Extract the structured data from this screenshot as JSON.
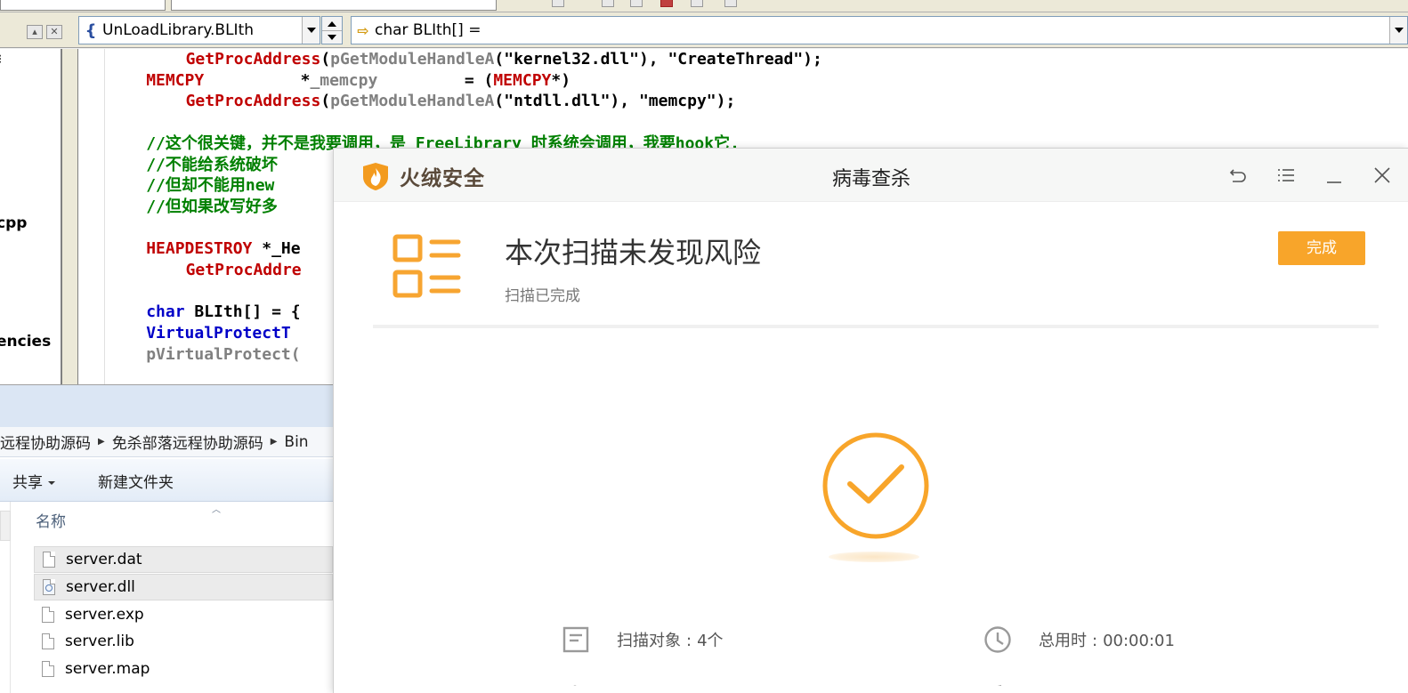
{
  "ide": {
    "class_combo": {
      "value": "UnLoadLibrary.BLIth",
      "icon": "class-icon"
    },
    "member_combo": {
      "value": "char BLIth[] =",
      "icon": "arrow-right-icon"
    },
    "file_tree": [
      {
        "text": "cpp"
      },
      {
        "text": "encies"
      }
    ],
    "code": [
      {
        "indent": "      ",
        "parts": [
          [
            "GetProcAddress",
            "red"
          ],
          [
            "(",
            "black"
          ],
          [
            "pGetModuleHandleA",
            "gray"
          ],
          [
            "(\"kernel32.dll\"), \"CreateThread\");",
            "black"
          ]
        ]
      },
      {
        "indent": "  ",
        "parts": [
          [
            "MEMCPY",
            "red"
          ],
          [
            "          *",
            "black"
          ],
          [
            "_memcpy",
            "gray"
          ],
          [
            "         = (",
            "black"
          ],
          [
            "MEMCPY",
            "red"
          ],
          [
            "*)",
            "black"
          ]
        ]
      },
      {
        "indent": "      ",
        "parts": [
          [
            "GetProcAddress",
            "red"
          ],
          [
            "(",
            "black"
          ],
          [
            "pGetModuleHandleA",
            "gray"
          ],
          [
            "(\"ntdll.dll\"), \"memcpy\");",
            "black"
          ]
        ]
      },
      {
        "indent": "",
        "parts": []
      },
      {
        "indent": "  ",
        "parts": [
          [
            "//这个很关键，并不是我要调用，是 FreeLibrary 时系统会调用，我要hook它.",
            "green"
          ]
        ]
      },
      {
        "indent": "  ",
        "parts": [
          [
            "//不能给系统破坏",
            "green"
          ]
        ]
      },
      {
        "indent": "  ",
        "parts": [
          [
            "//但却不能用new",
            "green"
          ]
        ]
      },
      {
        "indent": "  ",
        "parts": [
          [
            "//但如果改写好多",
            "green"
          ]
        ]
      },
      {
        "indent": "",
        "parts": []
      },
      {
        "indent": "  ",
        "parts": [
          [
            "HEAPDESTROY",
            "red"
          ],
          [
            " *_He",
            "black"
          ]
        ]
      },
      {
        "indent": "      ",
        "parts": [
          [
            "GetProcAddre",
            "red"
          ]
        ]
      },
      {
        "indent": "",
        "parts": []
      },
      {
        "indent": "  ",
        "parts": [
          [
            "char",
            "blue"
          ],
          [
            " BLIth[] = {",
            "black"
          ]
        ]
      },
      {
        "indent": "  ",
        "parts": [
          [
            "VirtualProtectT",
            "blue"
          ]
        ]
      },
      {
        "indent": "  ",
        "parts": [
          [
            "pVirtualProtect(",
            "gray"
          ]
        ]
      }
    ],
    "colors": {
      "red": "#c00000",
      "gray": "#808080",
      "blue": "#0000c8",
      "green": "#008000",
      "black": "#000000"
    }
  },
  "explorer": {
    "breadcrumb": [
      "远程协助源码",
      "免杀部落远程协助源码",
      "Bin"
    ],
    "commands": {
      "share": "共享",
      "new_folder": "新建文件夹"
    },
    "column_name": "名称",
    "files": [
      {
        "name": "server.dat",
        "type": "plain"
      },
      {
        "name": "server.dll",
        "type": "dll"
      },
      {
        "name": "server.exp",
        "type": "plain"
      },
      {
        "name": "server.lib",
        "type": "plain"
      },
      {
        "name": "server.map",
        "type": "plain"
      }
    ]
  },
  "popup": {
    "brand": "火绒安全",
    "title": "病毒查杀",
    "result_title": "本次扫描未发现风险",
    "result_subtitle": "扫描已完成",
    "done_button": "完成",
    "accent_color": "#f8a52a",
    "stats": {
      "objects_label": "扫描对象",
      "objects_value": "4个",
      "time_label": "总用时",
      "time_value": "00:00:01",
      "separator": ":"
    }
  }
}
